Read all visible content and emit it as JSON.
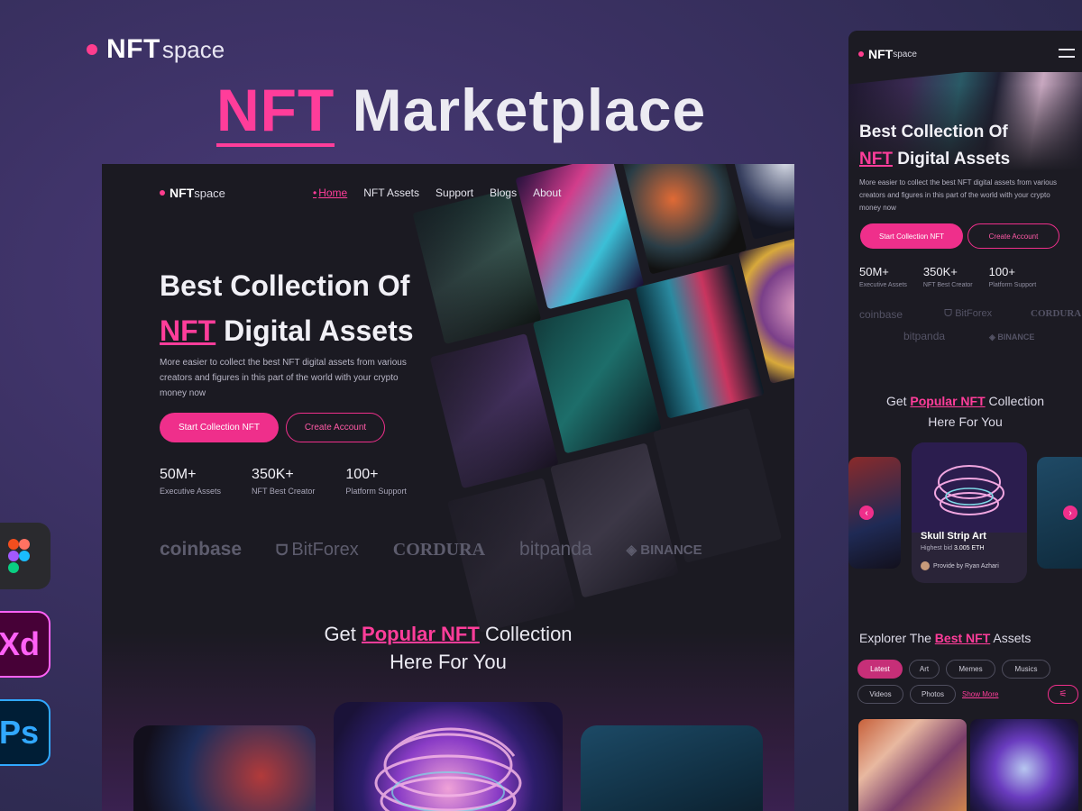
{
  "header": {
    "brand_main": "NFT",
    "brand_sub": "space",
    "title_accent": "NFT",
    "title_rest": "Marketplace"
  },
  "desktop": {
    "logo_main": "NFT",
    "logo_sub": "space",
    "nav": [
      "Home",
      "NFT Assets",
      "Support",
      "Blogs",
      "About"
    ],
    "hero_line1": "Best Collection Of",
    "hero_accent": "NFT",
    "hero_line2_rest": "Digital Assets",
    "lead": "More easier to collect the best NFT digital assets from various creators and figures in this part of the world with your crypto money now",
    "btn_primary": "Start Collection NFT",
    "btn_secondary": "Create Account",
    "stats": [
      {
        "value": "50M+",
        "label": "Executive Assets"
      },
      {
        "value": "350K+",
        "label": "NFT Best Creator"
      },
      {
        "value": "100+",
        "label": "Platform Support"
      }
    ],
    "partners": [
      "coinbase",
      "BitForex",
      "CORDURA",
      "bitpanda",
      "BINANCE"
    ],
    "popular_pre": "Get",
    "popular_accent": "Popular NFT",
    "popular_post": "Collection",
    "popular_line2": "Here For You"
  },
  "mobile": {
    "logo_main": "NFT",
    "logo_sub": "space",
    "hero_line1": "Best Collection Of",
    "hero_accent": "NFT",
    "hero_line2_rest": "Digital Assets",
    "lead": "More easier to collect the best NFT digital assets from various creators and figures in this part of the world with your crypto money now",
    "btn_primary": "Start Collection NFT",
    "btn_secondary": "Create Account",
    "stats": [
      {
        "value": "50M+",
        "label": "Executive Assets"
      },
      {
        "value": "350K+",
        "label": "NFT Best Creator"
      },
      {
        "value": "100+",
        "label": "Platform Support"
      }
    ],
    "partners": [
      "coinbase",
      "BitForex",
      "CORDURA",
      "bitpanda",
      "BINANCE"
    ],
    "popular_pre": "Get",
    "popular_accent": "Popular NFT",
    "popular_post": "Collection",
    "popular_line2": "Here For You",
    "card_title": "Skull Strip Art",
    "card_bid_label": "Highest bid",
    "card_bid_value": "3.005 ETH",
    "card_provider": "Provide by Ryan Azhari",
    "explore_pre": "Explorer The",
    "explore_accent": "Best NFT",
    "explore_post": "Assets",
    "chips": [
      "Latest",
      "Art",
      "Memes",
      "Musics",
      "Videos",
      "Photos"
    ],
    "show_more": "Show More"
  },
  "apps": [
    "Figma",
    "Xd",
    "Ps"
  ],
  "colors": {
    "accent": "#ff3d9a",
    "button": "#ef2f8b",
    "bg": "#1b1a22"
  }
}
